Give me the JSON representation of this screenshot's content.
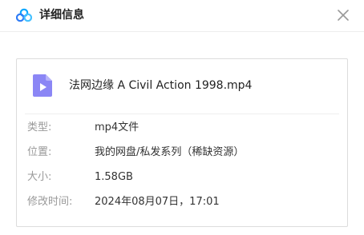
{
  "dialog": {
    "title": "详细信息",
    "close_icon": "close-icon",
    "logo_icon": "cloud-logo-icon",
    "colors": {
      "accent": "#06a7ff",
      "file_icon": "#8b86f5",
      "label": "#999999",
      "value": "#333333"
    }
  },
  "file": {
    "name": "法网边缘 A Civil Action 1998.mp4",
    "icon": "video-file-icon"
  },
  "info": {
    "type_label": "类型:",
    "type_value": "mp4文件",
    "location_label": "位置:",
    "location_value": "我的网盘/私发系列（稀缺资源）",
    "size_label": "大小:",
    "size_value": "1.58GB",
    "modified_label": "修改时间:",
    "modified_value": "2024年08月07日，17:01"
  }
}
